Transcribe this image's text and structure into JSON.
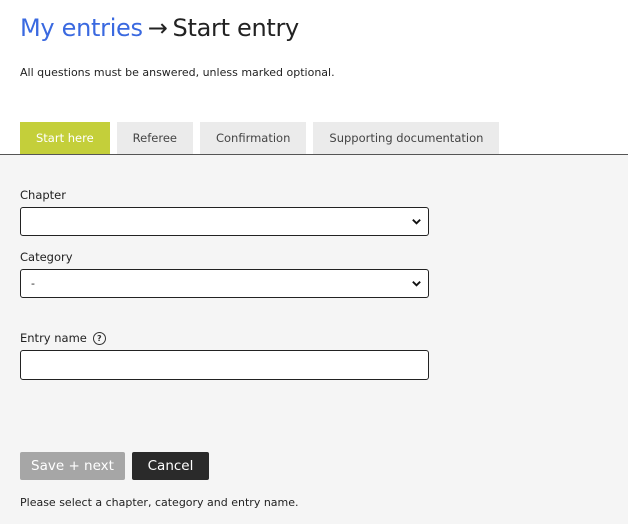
{
  "header": {
    "breadcrumb_link": "My entries",
    "breadcrumb_arrow": "→",
    "breadcrumb_current": "Start entry",
    "notice": "All questions must be answered, unless marked optional."
  },
  "tabs": [
    {
      "label": "Start here",
      "active": true
    },
    {
      "label": "Referee",
      "active": false
    },
    {
      "label": "Confirmation",
      "active": false
    },
    {
      "label": "Supporting documentation",
      "active": false
    }
  ],
  "form": {
    "chapter": {
      "label": "Chapter",
      "selected": ""
    },
    "category": {
      "label": "Category",
      "selected": "-"
    },
    "entry_name": {
      "label": "Entry name",
      "value": "",
      "help_icon": "question-circle-icon"
    },
    "save_label": "Save + next",
    "cancel_label": "Cancel",
    "hint": "Please select a chapter, category and entry name."
  },
  "colors": {
    "link": "#3a69e0",
    "active_tab": "#c4cf3a",
    "save_disabled": "#a6a6a6",
    "cancel": "#2a2a2a",
    "form_bg": "#f5f5f5"
  }
}
